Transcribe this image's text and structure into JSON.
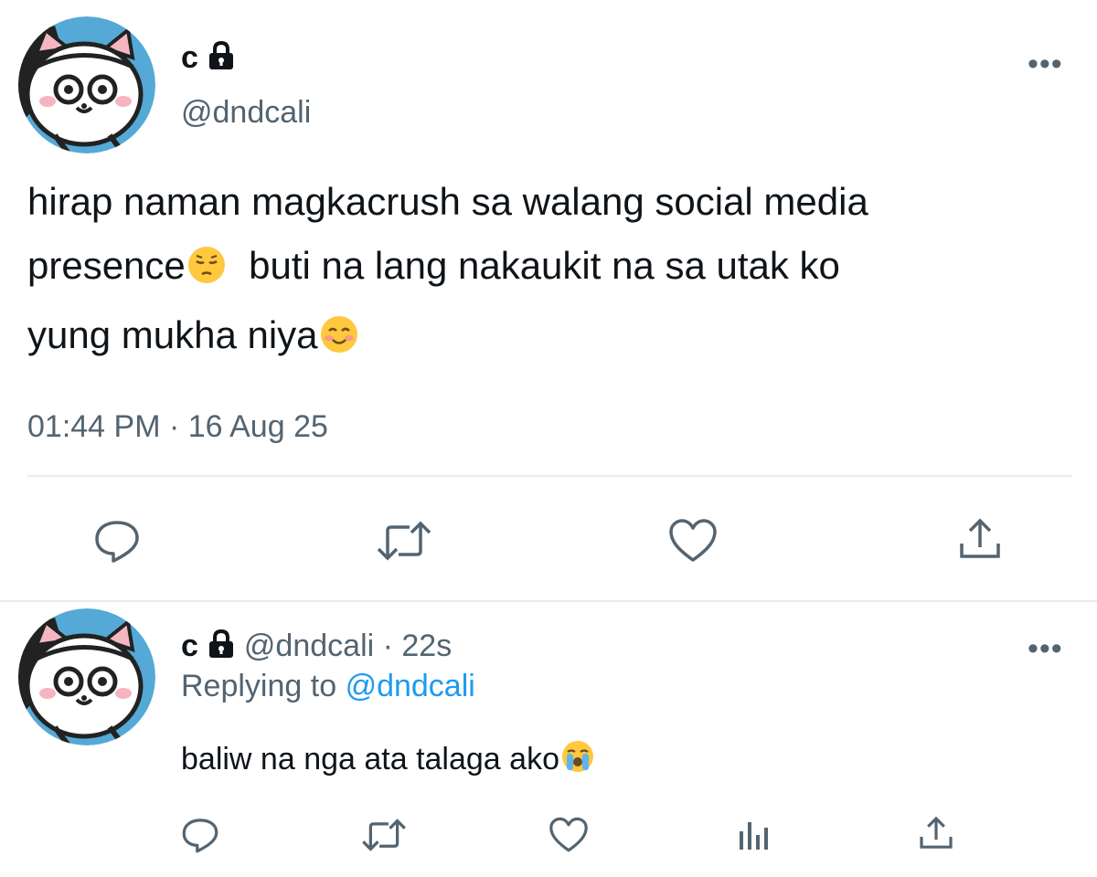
{
  "main_tweet": {
    "display_name": "c",
    "handle": "@dndcali",
    "text_line1": "hirap naman magkacrush sa walang social media",
    "text_line2a": "presence",
    "text_line2b": "buti na lang nakaukit na sa utak ko",
    "text_line3": "yung mukha niya",
    "emoji_1": "pensive-face",
    "emoji_2": "smiling-face",
    "timestamp": "01:44 PM · 16 Aug 25",
    "more_label": "•••",
    "actions": [
      "reply-icon",
      "retweet-icon",
      "like-icon",
      "share-icon"
    ]
  },
  "reply_tweet": {
    "display_name": "c",
    "handle_time": "@dndcali · 22s",
    "replying_prefix": "Replying to",
    "replying_handle": "@dndcali",
    "text": "baliw na nga ata talaga ako",
    "emoji": "loudly-crying-face",
    "more_label": "•••",
    "actions": [
      "reply-icon",
      "retweet-icon",
      "analytics-icon",
      "share-icon"
    ]
  },
  "colors": {
    "text": "#0f1419",
    "secondary": "#536471",
    "link": "#1d9bf0",
    "divider": "#e6ecf0"
  }
}
